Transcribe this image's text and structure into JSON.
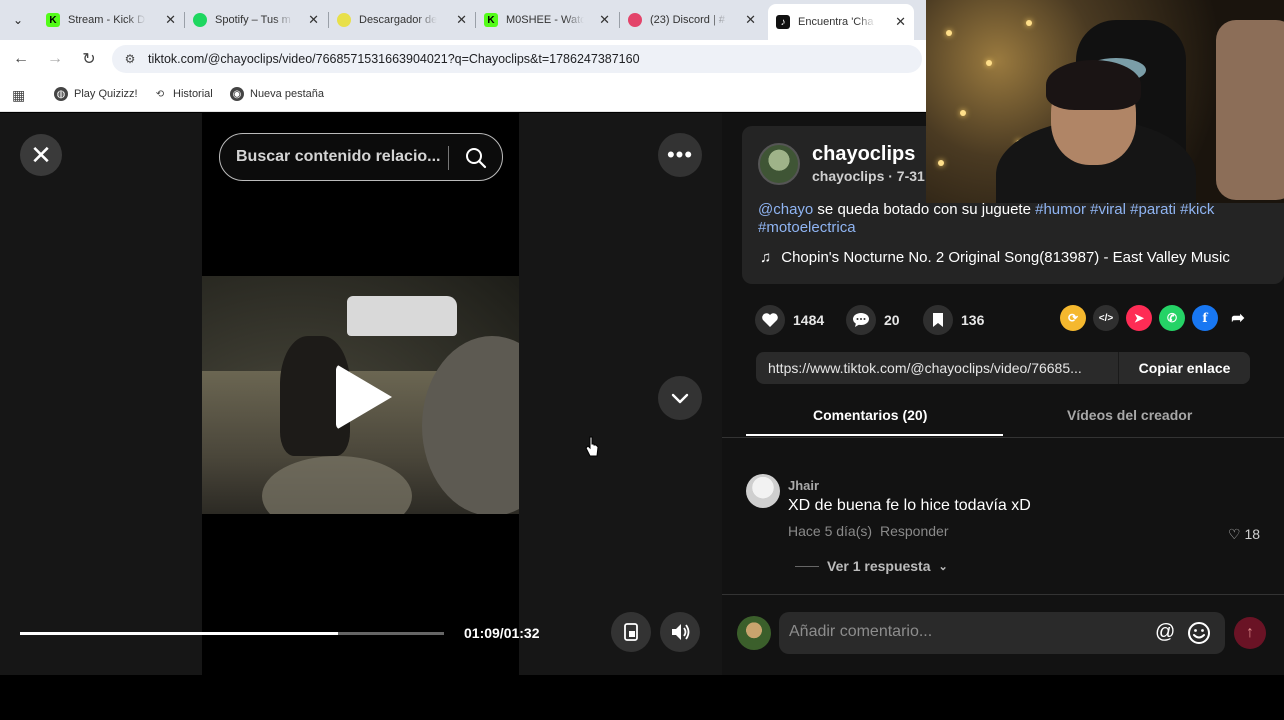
{
  "browser": {
    "tabs": [
      {
        "title": "Stream - Kick D",
        "favicon": "kick-icon",
        "color": "#53fc18"
      },
      {
        "title": "Spotify – Tus m",
        "favicon": "spotify-icon",
        "color": "#1ed760"
      },
      {
        "title": "Descargador de",
        "favicon": "download-icon",
        "color": "#e8e04a"
      },
      {
        "title": "M0SHEE - Watc",
        "favicon": "kick-icon",
        "color": "#53fc18"
      },
      {
        "title": "(23) Discord | #",
        "favicon": "discord-icon",
        "color": "#e3446a"
      },
      {
        "title": "Encuentra 'Cha",
        "favicon": "tiktok-icon",
        "color": "#111111"
      }
    ],
    "url": "tiktok.com/@chayoclips/video/7668571531663904021?q=Chayoclips&t=1786247387160",
    "bookmarks": [
      {
        "label": "Play Quizizz!",
        "icon": "globe-icon"
      },
      {
        "label": "Historial",
        "icon": "history-icon"
      },
      {
        "label": "Nueva pestaña",
        "icon": "chrome-icon"
      }
    ]
  },
  "player": {
    "search_placeholder": "Buscar contenido relacio...",
    "time": "01:09/01:32",
    "progress": 0.75
  },
  "post": {
    "username": "chayoclips",
    "subline": "chayoclips · 7-31",
    "caption_mention": "@chayo",
    "caption_text": " se queda botado con su juguete ",
    "caption_tags": "#humor #viral #parati #kick #motoelectrica",
    "music": "Chopin's Nocturne No. 2 Original Song(813987) - East Valley Music",
    "likes": "1484",
    "comments": "20",
    "saves": "136",
    "link": "https://www.tiktok.com/@chayoclips/video/76685...",
    "copy_label": "Copiar enlace"
  },
  "tabs": {
    "comments": "Comentarios (20)",
    "creator_videos": "Vídeos del creador"
  },
  "comment": {
    "user": "Jhair",
    "text": "XD de buena fe lo hice todavía xD",
    "time": "Hace 5 día(s)",
    "reply": "Responder",
    "likes": "18",
    "more_replies": "Ver 1 respuesta"
  },
  "composer": {
    "placeholder": "Añadir comentario..."
  },
  "colors": {
    "accent_tag": "#8fb4f2",
    "send": "#6a1325"
  }
}
